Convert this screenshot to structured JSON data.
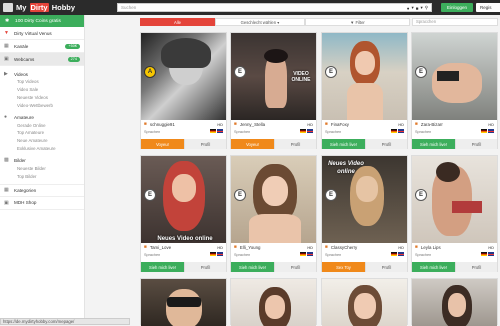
{
  "header": {
    "logo_text_pre": "My",
    "logo_text_mid": "Dirty",
    "logo_text_post": "Hobby",
    "search_placeholder": "Suchen",
    "login_label": "Einloggen",
    "register_label": "Regis"
  },
  "sidebar": {
    "promo": "100 Dirty Coins gratis",
    "venus": "Dirty Virtual Venus",
    "channels": "Kanäle",
    "channels_badge": "+50€",
    "webcams": "Webcams",
    "webcams_badge": "274",
    "videos": "Videos",
    "videos_sub": [
      "Top Videos",
      "Video Sale",
      "Neueste Videos",
      "Video-Wettbewerb"
    ],
    "amateurs": "Amateure",
    "amateurs_sub": [
      "Gerade Online",
      "Top Amateure",
      "Neue Amateure",
      "Exklusive Amateure"
    ],
    "images": "Bilder",
    "images_sub": [
      "Neueste Bilder",
      "Top Bilder"
    ],
    "categories": "Kategorien",
    "shop": "MDH Shop"
  },
  "filters": {
    "all": "Alle",
    "gender": "Geschlecht wählen",
    "filter": "Filter",
    "search_placeholder": "Spracchen"
  },
  "cards": [
    {
      "name": "schnuggie91",
      "hd": "HD",
      "lang": "Sprachen",
      "badge": "A",
      "badge_gold": true,
      "action": "Voyeur",
      "action_color": "orange",
      "profile": "Profil",
      "overlay": ""
    },
    {
      "name": "Jenny_Stella",
      "hd": "HD",
      "lang": "Sprachen",
      "badge": "E",
      "badge_gold": false,
      "action": "Voyeur",
      "action_color": "orange",
      "profile": "Profil",
      "overlay": "VIDEO ONLINE"
    },
    {
      "name": "FinaFoxy",
      "hd": "HD",
      "lang": "Sprachen",
      "badge": "E",
      "badge_gold": false,
      "action": "Sieh mich live!",
      "action_color": "green",
      "profile": "Profil",
      "overlay": ""
    },
    {
      "name": "Zara-Bizarr",
      "hd": "HD",
      "lang": "Sprachen",
      "badge": "E",
      "badge_gold": false,
      "action": "Sieh mich live!",
      "action_color": "green",
      "profile": "Profil",
      "overlay": ""
    },
    {
      "name": "Tami_Love",
      "hd": "HD",
      "lang": "Sprachen",
      "badge": "E",
      "badge_gold": false,
      "action": "Sieh mich live!",
      "action_color": "green",
      "profile": "Profil",
      "overlay": "Neues Video online"
    },
    {
      "name": "Elli_Young",
      "hd": "HD",
      "lang": "Sprachen",
      "badge": "E",
      "badge_gold": false,
      "action": "Sieh mich live!",
      "action_color": "green",
      "profile": "Profil",
      "overlay": ""
    },
    {
      "name": "ClassyCherry",
      "hd": "HD",
      "lang": "Sprachen",
      "badge": "E",
      "badge_gold": false,
      "action": "Sex Toy",
      "action_color": "orange",
      "profile": "Profil",
      "overlay": "Neues Video online"
    },
    {
      "name": "Leyla Lips",
      "hd": "HD",
      "lang": "Sprachen",
      "badge": "E",
      "badge_gold": false,
      "action": "Sieh mich live!",
      "action_color": "green",
      "profile": "Profil",
      "overlay": ""
    }
  ],
  "status_url": "https://de.mydirtyhobby.com/mepage/",
  "colors": {
    "accent_green": "#3cae5c",
    "accent_orange": "#f0891a",
    "accent_red": "#e4443a",
    "topbar": "#2b2b2b"
  }
}
